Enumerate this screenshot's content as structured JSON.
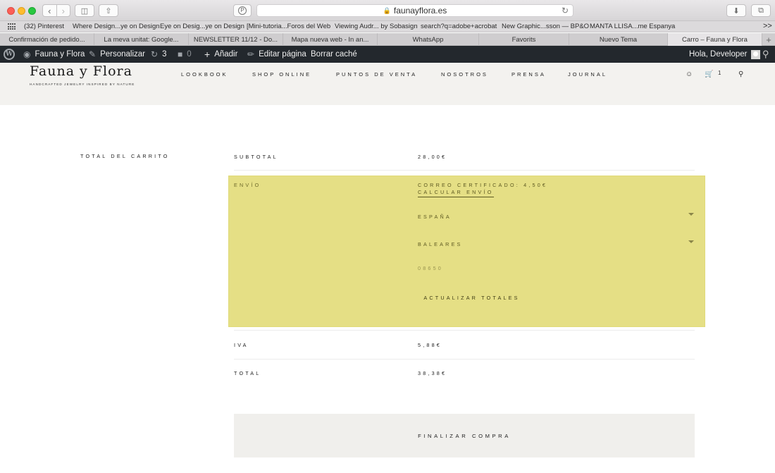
{
  "browser": {
    "url": "faunayflora.es",
    "bookmarks": [
      "(32) Pinterest",
      "Where Design...ye on Design",
      "Eye on Desig...ye on Design",
      "[Mini-tutoria...Foros del Web",
      "Viewing Audr... by Sobasign",
      "search?q=adobe+acrobat",
      "New Graphic...sson — BP&O",
      "MANTA LLISA...me Espanya"
    ],
    "overflow": ">>",
    "tabs": [
      "Confirmación de pedido...",
      "La meva unitat: Google...",
      "NEWSLETTER 11/12 - Do...",
      "Mapa nueva web - In an...",
      "WhatsApp",
      "Favorits",
      "Nuevo Tema",
      "Carro – Fauna y Flora"
    ],
    "active_tab": 7,
    "new_tab": "+"
  },
  "wpbar": {
    "site": "Fauna y Flora",
    "customize": "Personalizar",
    "updates": "3",
    "comments": "0",
    "add_new": "Añadir",
    "edit_page": "Editar página",
    "clear_cache": "Borrar caché",
    "greeting": "Hola, Developer"
  },
  "header": {
    "logo": "Fauna y Flora",
    "tagline": "HANDCRAFTED JEWELRY INSPIRED BY NATURE",
    "nav": [
      "LOOKBOOK",
      "SHOP ONLINE",
      "PUNTOS DE VENTA",
      "NOSOTROS",
      "PRENSA",
      "JOURNAL"
    ],
    "cart_count": "1"
  },
  "cart": {
    "heading": "TOTAL DEL CARRITO",
    "subtotal_label": "SUBTOTAL",
    "subtotal_value": "28,00€",
    "shipping_label": "ENVÍO",
    "shipping_method": "CORREO CERTIFICADO: 4,50€",
    "calc_shipping": "CALCULAR ENVÍO",
    "country": "ESPAÑA",
    "region": "BALEARES",
    "postcode": "08650",
    "update_totals": "ACTUALIZAR TOTALES",
    "tax_label": "IVA",
    "tax_value": "5,88€",
    "total_label": "TOTAL",
    "total_value": "38,38€",
    "checkout": "FINALIZAR COMPRA"
  },
  "colors": {
    "highlight": "#e5df85",
    "wpbar": "#23282d",
    "header_bg": "#f3f2ef",
    "checkout_bg": "#f0efec"
  },
  "icons": [
    "back-icon",
    "forward-icon",
    "sidebar-icon",
    "share-icon",
    "pinterest-icon",
    "lock-icon",
    "reload-icon",
    "download-icon",
    "tab-overview-icon",
    "wordpress-icon",
    "dashboard-icon",
    "brush-icon",
    "updates-icon",
    "comment-icon",
    "plus-icon",
    "pencil-icon",
    "search-icon",
    "user-icon",
    "cart-icon"
  ]
}
